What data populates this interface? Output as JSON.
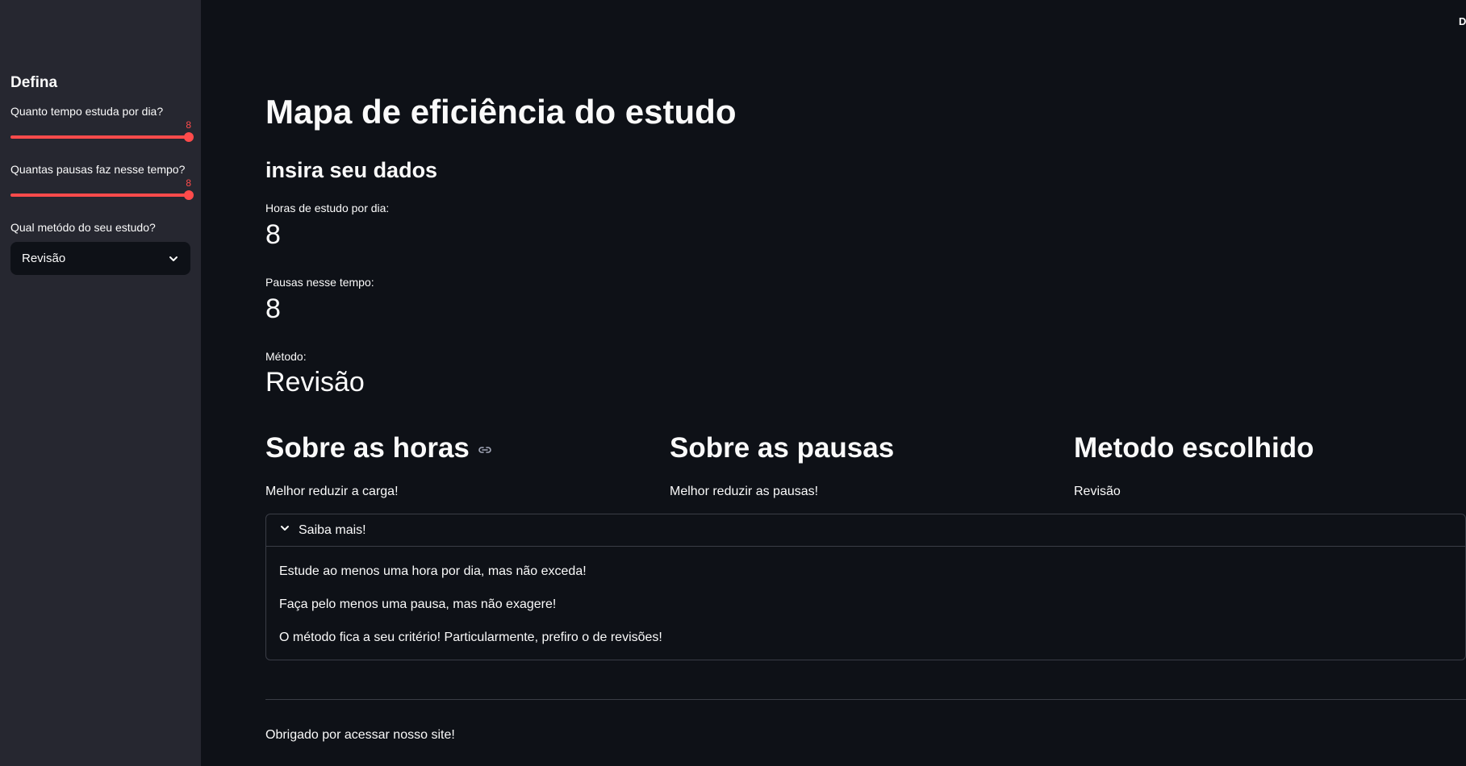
{
  "header": {
    "deploy_label": "Deploy"
  },
  "sidebar": {
    "title": "Defina",
    "hours_slider": {
      "label": "Quanto tempo estuda por dia?",
      "value": "8",
      "level": 1.0
    },
    "breaks_slider": {
      "label": "Quantas pausas faz nesse tempo?",
      "value": "8",
      "level": 1.0
    },
    "method_select": {
      "label": "Qual metódo do seu estudo?",
      "selected": "Revisão"
    }
  },
  "main": {
    "title": "Mapa de eficiência do estudo",
    "subheader": "insira seu dados",
    "metrics": [
      {
        "label": "Horas de estudo por dia:",
        "value": "8"
      },
      {
        "label": "Pausas nesse tempo:",
        "value": "8"
      },
      {
        "label": "Método:",
        "value": "Revisão"
      }
    ],
    "columns": [
      {
        "title": "Sobre as horas",
        "text": "Melhor reduzir a carga!"
      },
      {
        "title": "Sobre as pausas",
        "text": "Melhor reduzir as pausas!"
      },
      {
        "title": "Metodo escolhido",
        "text": "Revisão"
      }
    ],
    "expander": {
      "label": "Saiba mais!",
      "lines": [
        "Estude ao menos uma hora por dia, mas não exceda!",
        "Faça pelo menos uma pausa, mas não exagere!",
        "O método fica a seu critério! Particularmente, prefiro o de revisões!"
      ]
    },
    "footer": "Obrigado por acessar nosso site!"
  },
  "colors": {
    "background": "#0e1117",
    "sidebar": "#262730",
    "accent": "#ff4b4b",
    "text": "#fafafa"
  }
}
